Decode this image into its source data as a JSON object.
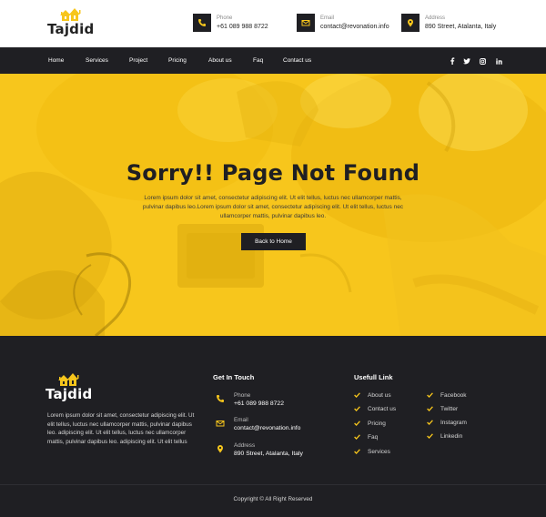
{
  "brand": {
    "name": "Tajdid",
    "accent": "#f7c61c",
    "dark": "#1f1f23"
  },
  "header": {
    "contacts": [
      {
        "icon": "phone-icon",
        "label": "Phone",
        "value": "+61 089 988 8722"
      },
      {
        "icon": "mail-icon",
        "label": "Email",
        "value": "contact@revonation.info"
      },
      {
        "icon": "location-pin-icon",
        "label": "Address",
        "value": "890 Street, Atalanta, Italy"
      }
    ]
  },
  "nav": {
    "items": [
      "Home",
      "Services",
      "Project",
      "Pricing",
      "About us",
      "Faq",
      "Contact us"
    ],
    "social": [
      "facebook-icon",
      "twitter-icon",
      "instagram-icon",
      "linkedin-icon"
    ]
  },
  "hero": {
    "title": "Sorry!! Page Not Found",
    "text": "Lorem ipsum dolor sit amet, consectetur adipiscing elit. Ut elit tellus, luctus nec ullamcorper mattis, pulvinar dapibus leo.Lorem ipsum dolor sit amet, consectetur adipiscing elit. Ut elit tellus, luctus nec ullamcorper mattis, pulvinar dapibus leo.",
    "button": "Back to Home"
  },
  "footer": {
    "about": "Lorem ipsum dolor sit amet, consectetur adipiscing elit. Ut elit tellus, luctus nec ullamcorper mattis, pulvinar dapibus leo. adipiscing elit. Ut elit tellus, luctus nec ullamcorper mattis, pulvinar dapibus leo. adipiscing elit. Ut elit tellus",
    "get_in_touch": {
      "heading": "Get In Touch",
      "items": [
        {
          "icon": "phone-icon",
          "label": "Phone",
          "value": "+61 089 988 8722"
        },
        {
          "icon": "mail-icon",
          "label": "Email",
          "value": "contact@revonation.info"
        },
        {
          "icon": "location-pin-icon",
          "label": "Address",
          "value": "890 Street, Atalanta, Italy"
        }
      ]
    },
    "useful_links": {
      "heading": "Usefull Link",
      "col1": [
        "About us",
        "Contact us",
        "Pricing",
        "Faq",
        "Services"
      ],
      "col2": [
        "Facebook",
        "Twitter",
        "Instagram",
        "Linkedin"
      ]
    },
    "copyright": "Copyright © All Right Reserved"
  }
}
